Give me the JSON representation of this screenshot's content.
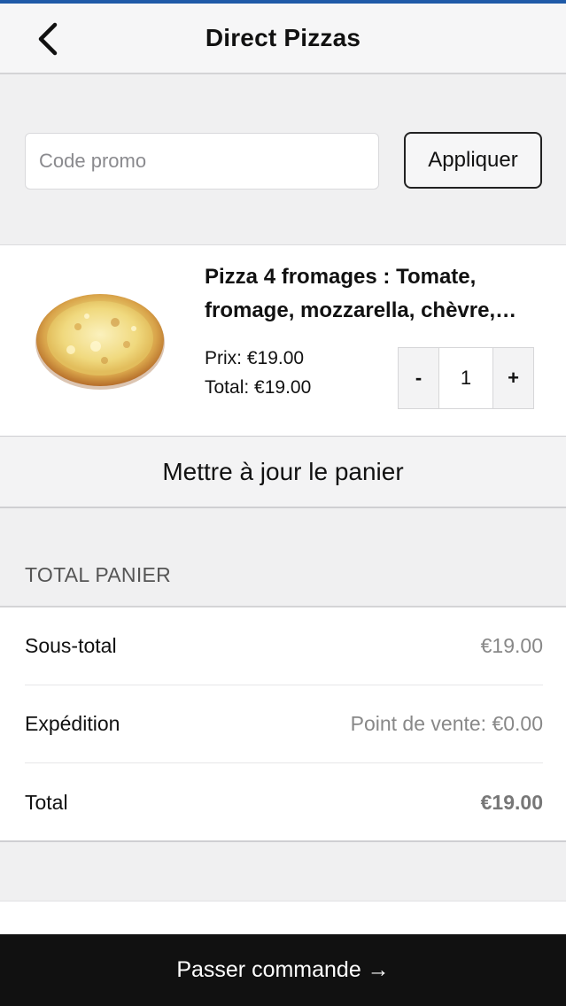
{
  "header": {
    "title": "Direct Pizzas",
    "back_icon": "chevron-left-icon"
  },
  "promo": {
    "placeholder": "Code promo",
    "value": "",
    "apply_label": "Appliquer"
  },
  "cart": {
    "items": [
      {
        "name": "Pizza 4 fromages : Tomate, fromage, mozzarella, chèvre,…",
        "price": "Prix: €19.00",
        "total": "Total: €19.00",
        "quantity": "1",
        "minus_label": "-",
        "plus_label": "+",
        "image": "pizza-image"
      }
    ],
    "update_label": "Mettre à jour le panier"
  },
  "totals": {
    "heading": "TOTAL PANIER",
    "rows": [
      {
        "label": "Sous-total",
        "value": "€19.00"
      },
      {
        "label": "Expédition",
        "value": "Point de vente: €0.00"
      },
      {
        "label": "Total",
        "value": "€19.00"
      }
    ]
  },
  "checkout": {
    "label": "Passer commande →"
  },
  "colors": {
    "accent_top": "#1f5aa8",
    "checkout_bg": "#111111",
    "page_bg": "#f0f0f1"
  }
}
